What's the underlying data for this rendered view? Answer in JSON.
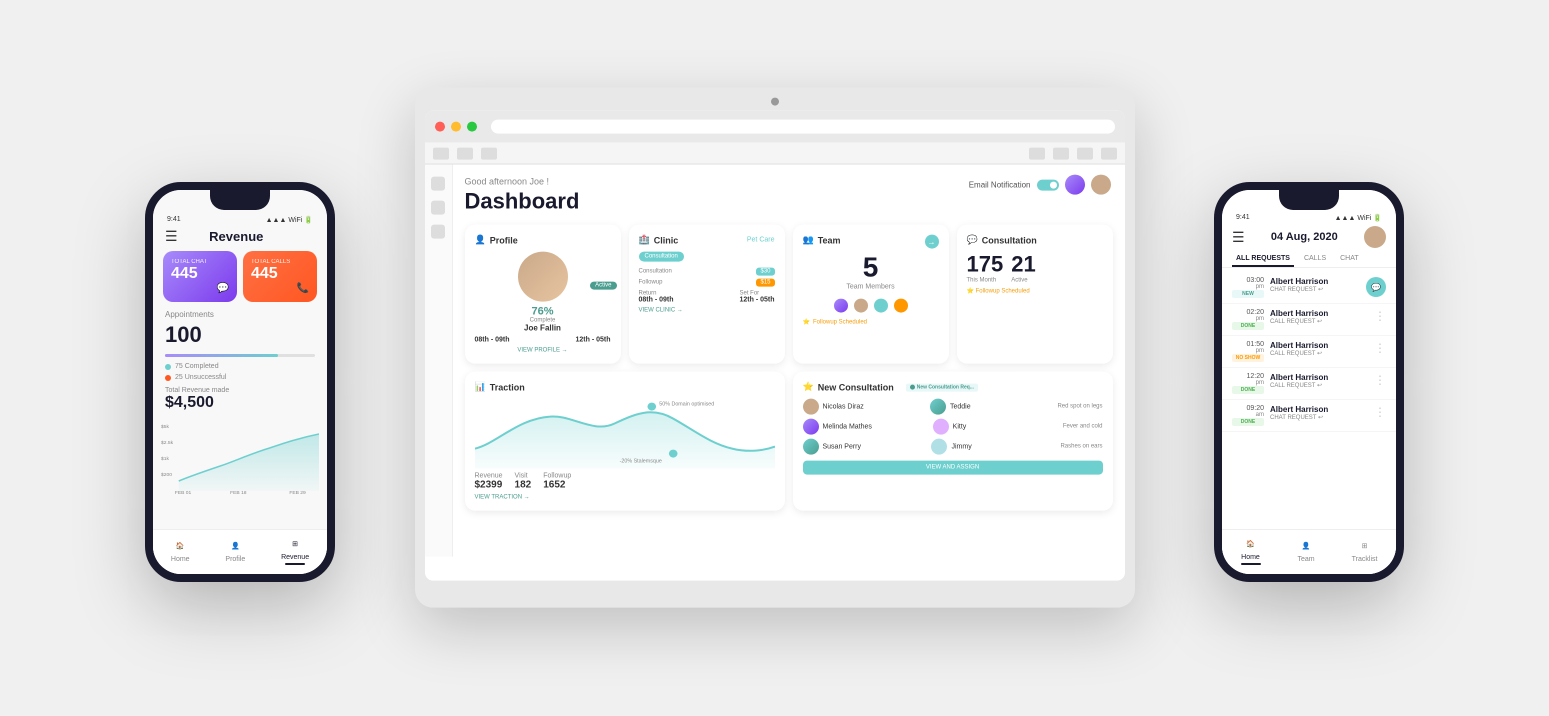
{
  "tablet": {
    "greeting": "Good afternoon Joe !",
    "dashboard_title": "Dashboard",
    "email_notification_label": "Email Notification",
    "profile_card": {
      "title": "Profile",
      "progress": "76%",
      "progress_label": "Complete",
      "name": "Joe Fallin",
      "tag": "Active",
      "date1_label": "08th - 09th",
      "date2_label": "12th - 05th"
    },
    "clinic_card": {
      "title": "Clinic",
      "tab1": "Consultation",
      "tab2": "Pet Care",
      "badge1": "$30",
      "badge2": "$15",
      "label1": "Return",
      "label2": "Set For",
      "time1": "08th - 09th",
      "time2": "12th - 05th"
    },
    "team_card": {
      "title": "Team",
      "count": "5",
      "label": "Team Members",
      "badge": "Followup Scheduled"
    },
    "consultation_card": {
      "title": "Consultation",
      "this_month": "175",
      "this_month_label": "This Month",
      "active": "21",
      "active_label": "Active",
      "item": "Followup Scheduled"
    },
    "traction_card": {
      "title": "Traction",
      "peak_label": "50% Domain optimised",
      "bottom_label": "-20% Stalemsque",
      "revenue_label": "Revenue",
      "revenue_value": "$2399",
      "visit_label": "Visit",
      "visit_value": "182",
      "followup_label": "Followup",
      "followup_value": "1652"
    },
    "new_consultation_card": {
      "title": "New Consultation",
      "new_badge": "New Consultation Req...",
      "rows": [
        {
          "name": "Nicolas Diraz",
          "pet": "Teddie",
          "topic": "Red spot on legs"
        },
        {
          "name": "Melinda Mathes",
          "pet": "Kitty",
          "topic": "Fever and cold"
        },
        {
          "name": "Susan Perry",
          "pet": "Jimmy",
          "topic": "Rashes on ears"
        }
      ],
      "btn_label": "VIEW AND ASSIGN"
    }
  },
  "phone_left": {
    "title": "Revenue",
    "time": "9:41",
    "total_chat_label": "TOTAL CHAT",
    "total_chat_value": "445",
    "total_calls_label": "TOTAL CALLS",
    "total_calls_value": "445",
    "appointments_label": "Appointments",
    "appointments_value": "100",
    "completed_label": "75 Completed",
    "unsuccessful_label": "25 Unsuccessful",
    "total_revenue_label": "Total Revenue made",
    "total_revenue_value": "$4,500",
    "chart_labels": [
      "FEB 01",
      "FEB 18",
      "FEB 29"
    ],
    "chart_y_labels": [
      "$5k",
      "$2.5k",
      "$1k",
      "$200"
    ],
    "nav_items": [
      "Home",
      "Profile",
      "Revenue"
    ]
  },
  "phone_right": {
    "time": "9:41",
    "date": "04 Aug, 2020",
    "tabs": [
      "ALL REQUESTS",
      "CALLS",
      "CHAT"
    ],
    "requests": [
      {
        "time": "03:00 pm",
        "status": "NEW",
        "name": "Albert Harrison",
        "type": "CHAT REQUEST",
        "has_chat_btn": true
      },
      {
        "time": "02:20 pm",
        "status": "DONE",
        "name": "Albert Harrison",
        "type": "CALL REQUEST",
        "has_chat_btn": false
      },
      {
        "time": "01:50 pm",
        "status": "NO SHOW",
        "name": "Albert Harrison",
        "type": "CALL REQUEST",
        "has_chat_btn": false
      },
      {
        "time": "12:20 pm",
        "status": "DONE",
        "name": "Albert Harrison",
        "type": "CALL REQUEST",
        "has_chat_btn": false
      },
      {
        "time": "09:20 am",
        "status": "DONE",
        "name": "Albert Harrison",
        "type": "CHAT REQUEST",
        "has_chat_btn": false
      }
    ],
    "nav_items": [
      "Home",
      "Team",
      "Tracklist"
    ]
  },
  "colors": {
    "teal": "#6ecfcf",
    "purple": "#a78bfa",
    "orange": "#ff7043",
    "dark": "#1a1a2e",
    "success": "#4caf50"
  }
}
